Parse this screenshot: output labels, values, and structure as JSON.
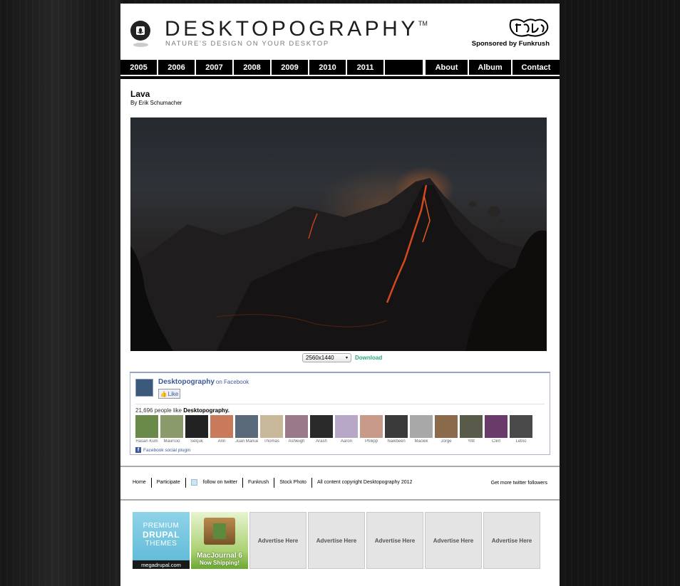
{
  "header": {
    "title": "DESKTOPOGRAPHY",
    "trademark": "TM",
    "tagline": "NATURE'S DESIGN ON YOUR DESKTOP",
    "sponsor": "Sponsored by Funkrush"
  },
  "nav": {
    "years": [
      "2005",
      "2006",
      "2007",
      "2008",
      "2009",
      "2010",
      "2011"
    ],
    "about": "About",
    "album": "Album",
    "contact": "Contact"
  },
  "artwork": {
    "title": "Lava",
    "author": "By Erik Schumacher",
    "resolution": "2560x1440",
    "download": "Download"
  },
  "facebook": {
    "page_name": "Desktopography",
    "on_facebook": "on Facebook",
    "like_label": "Like",
    "count_prefix": "21,696 people like",
    "count_page": "Desktopography.",
    "faces": [
      {
        "name": "Hasan Kum",
        "color": "#6a8a4a"
      },
      {
        "name": "Maurício",
        "color": "#8a9a6a"
      },
      {
        "name": "Selçuk",
        "color": "#222222"
      },
      {
        "name": "Arin",
        "color": "#c87a5a"
      },
      {
        "name": "Juan Manue",
        "color": "#5a6a7a"
      },
      {
        "name": "Thomas",
        "color": "#c8b89a"
      },
      {
        "name": "Ashleigh",
        "color": "#9a7a8a"
      },
      {
        "name": "Arash",
        "color": "#2a2a2a"
      },
      {
        "name": "Aaron",
        "color": "#b8a8c8"
      },
      {
        "name": "Philipp",
        "color": "#c89a8a"
      },
      {
        "name": "Naikbeen",
        "color": "#3a3a3a"
      },
      {
        "name": "Maciek",
        "color": "#a8a8a8"
      },
      {
        "name": "Jorge",
        "color": "#8a6a4a"
      },
      {
        "name": "Yifit",
        "color": "#5a5a4a"
      },
      {
        "name": "Clint",
        "color": "#6a3a6a"
      },
      {
        "name": "Letno",
        "color": "#4a4a4a"
      }
    ],
    "plugin_label": "Facebook social plugin"
  },
  "footer": {
    "home": "Home",
    "participate": "Participate",
    "twitter": "follow on twitter",
    "funkrush": "Funkrush",
    "stock": "Stock Photo",
    "copyright": "All content copyright Desktopography 2012",
    "twitter_followers": "Get more twitter followers"
  },
  "ads": {
    "drupal_line1": "PREMIUM",
    "drupal_line2": "DRUPAL",
    "drupal_line3": "THEMES",
    "drupal_url": "megadrupal.com",
    "mac_line1": "MacJournal 6",
    "mac_line2": "Now Shipping!",
    "advertise": "Advertise Here"
  }
}
